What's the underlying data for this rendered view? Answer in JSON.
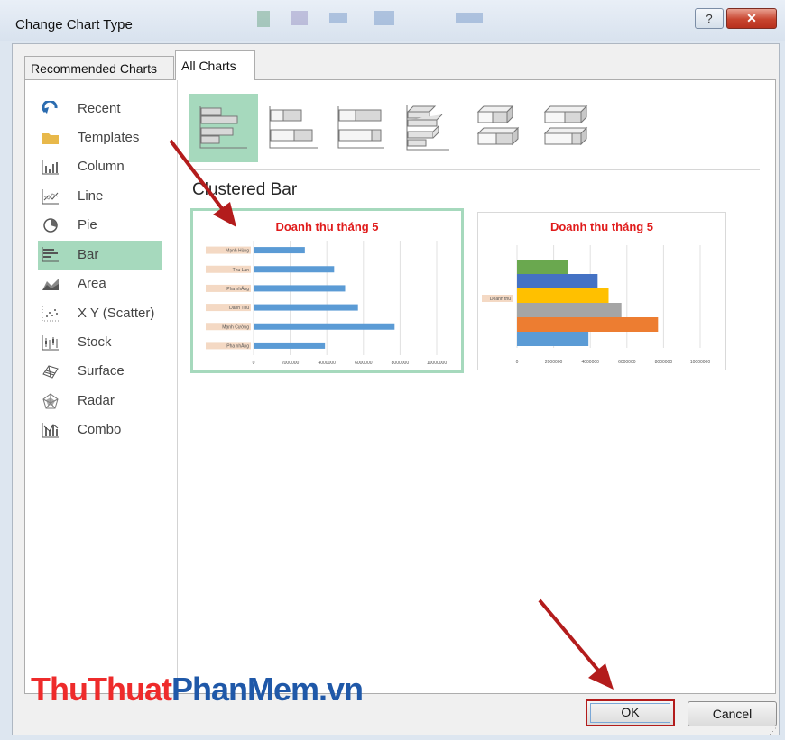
{
  "window": {
    "title": "Change Chart Type",
    "help_glyph": "?",
    "close_glyph": "✕"
  },
  "tabs": [
    {
      "label": "Recommended Charts",
      "selected": false
    },
    {
      "label": "All Charts",
      "selected": true
    }
  ],
  "categories": [
    {
      "label": "Recent",
      "icon": "recent-icon"
    },
    {
      "label": "Templates",
      "icon": "folder-icon"
    },
    {
      "label": "Column",
      "icon": "column-chart-icon"
    },
    {
      "label": "Line",
      "icon": "line-chart-icon"
    },
    {
      "label": "Pie",
      "icon": "pie-chart-icon"
    },
    {
      "label": "Bar",
      "icon": "bar-chart-icon",
      "selected": true
    },
    {
      "label": "Area",
      "icon": "area-chart-icon"
    },
    {
      "label": "X Y (Scatter)",
      "icon": "scatter-chart-icon"
    },
    {
      "label": "Stock",
      "icon": "stock-chart-icon"
    },
    {
      "label": "Surface",
      "icon": "surface-chart-icon"
    },
    {
      "label": "Radar",
      "icon": "radar-chart-icon"
    },
    {
      "label": "Combo",
      "icon": "combo-chart-icon"
    }
  ],
  "subtype_title": "Clustered Bar",
  "subtype_icons": [
    "clustered-bar-icon",
    "stacked-bar-icon",
    "100-stacked-bar-icon",
    "3d-clustered-bar-icon",
    "3d-stacked-bar-icon",
    "3d-100-stacked-bar-icon"
  ],
  "previews": [
    {
      "title": "Doanh thu tháng 5",
      "categories": [
        "Mạnh Hùng",
        "Thu Lan",
        "Pha nhĂng",
        "Danh Thu",
        "Mạnh Cường",
        "Pha nhĂng"
      ],
      "values": [
        2800000,
        4400000,
        5000000,
        5700000,
        7700000,
        3900000
      ],
      "x_ticks": [
        "0",
        "2000000",
        "4000000",
        "6000000",
        "8000000",
        "10000000"
      ],
      "xlim": [
        0,
        10000000
      ]
    },
    {
      "title": "Doanh thu tháng 5",
      "category": "Doanh thu",
      "values": [
        2800000,
        4400000,
        5000000,
        5700000,
        7700000,
        3900000
      ],
      "colors": [
        "#6aa84f",
        "#4472c4",
        "#ffc000",
        "#a5a5a5",
        "#ed7d31",
        "#5b9bd5"
      ],
      "x_ticks": [
        "0",
        "2000000",
        "4000000",
        "6000000",
        "8000000",
        "10000000"
      ],
      "xlim": [
        0,
        10000000
      ]
    }
  ],
  "buttons": {
    "ok": "OK",
    "cancel": "Cancel"
  },
  "watermark": {
    "part1": "ThuThuat",
    "part2": "PhanMem.vn"
  },
  "colors": {
    "selected_bg": "#a6d9bd",
    "bar_blue": "#5b9bd5",
    "arrow_red": "#b31c1c",
    "title_red": "#e01b1b"
  }
}
